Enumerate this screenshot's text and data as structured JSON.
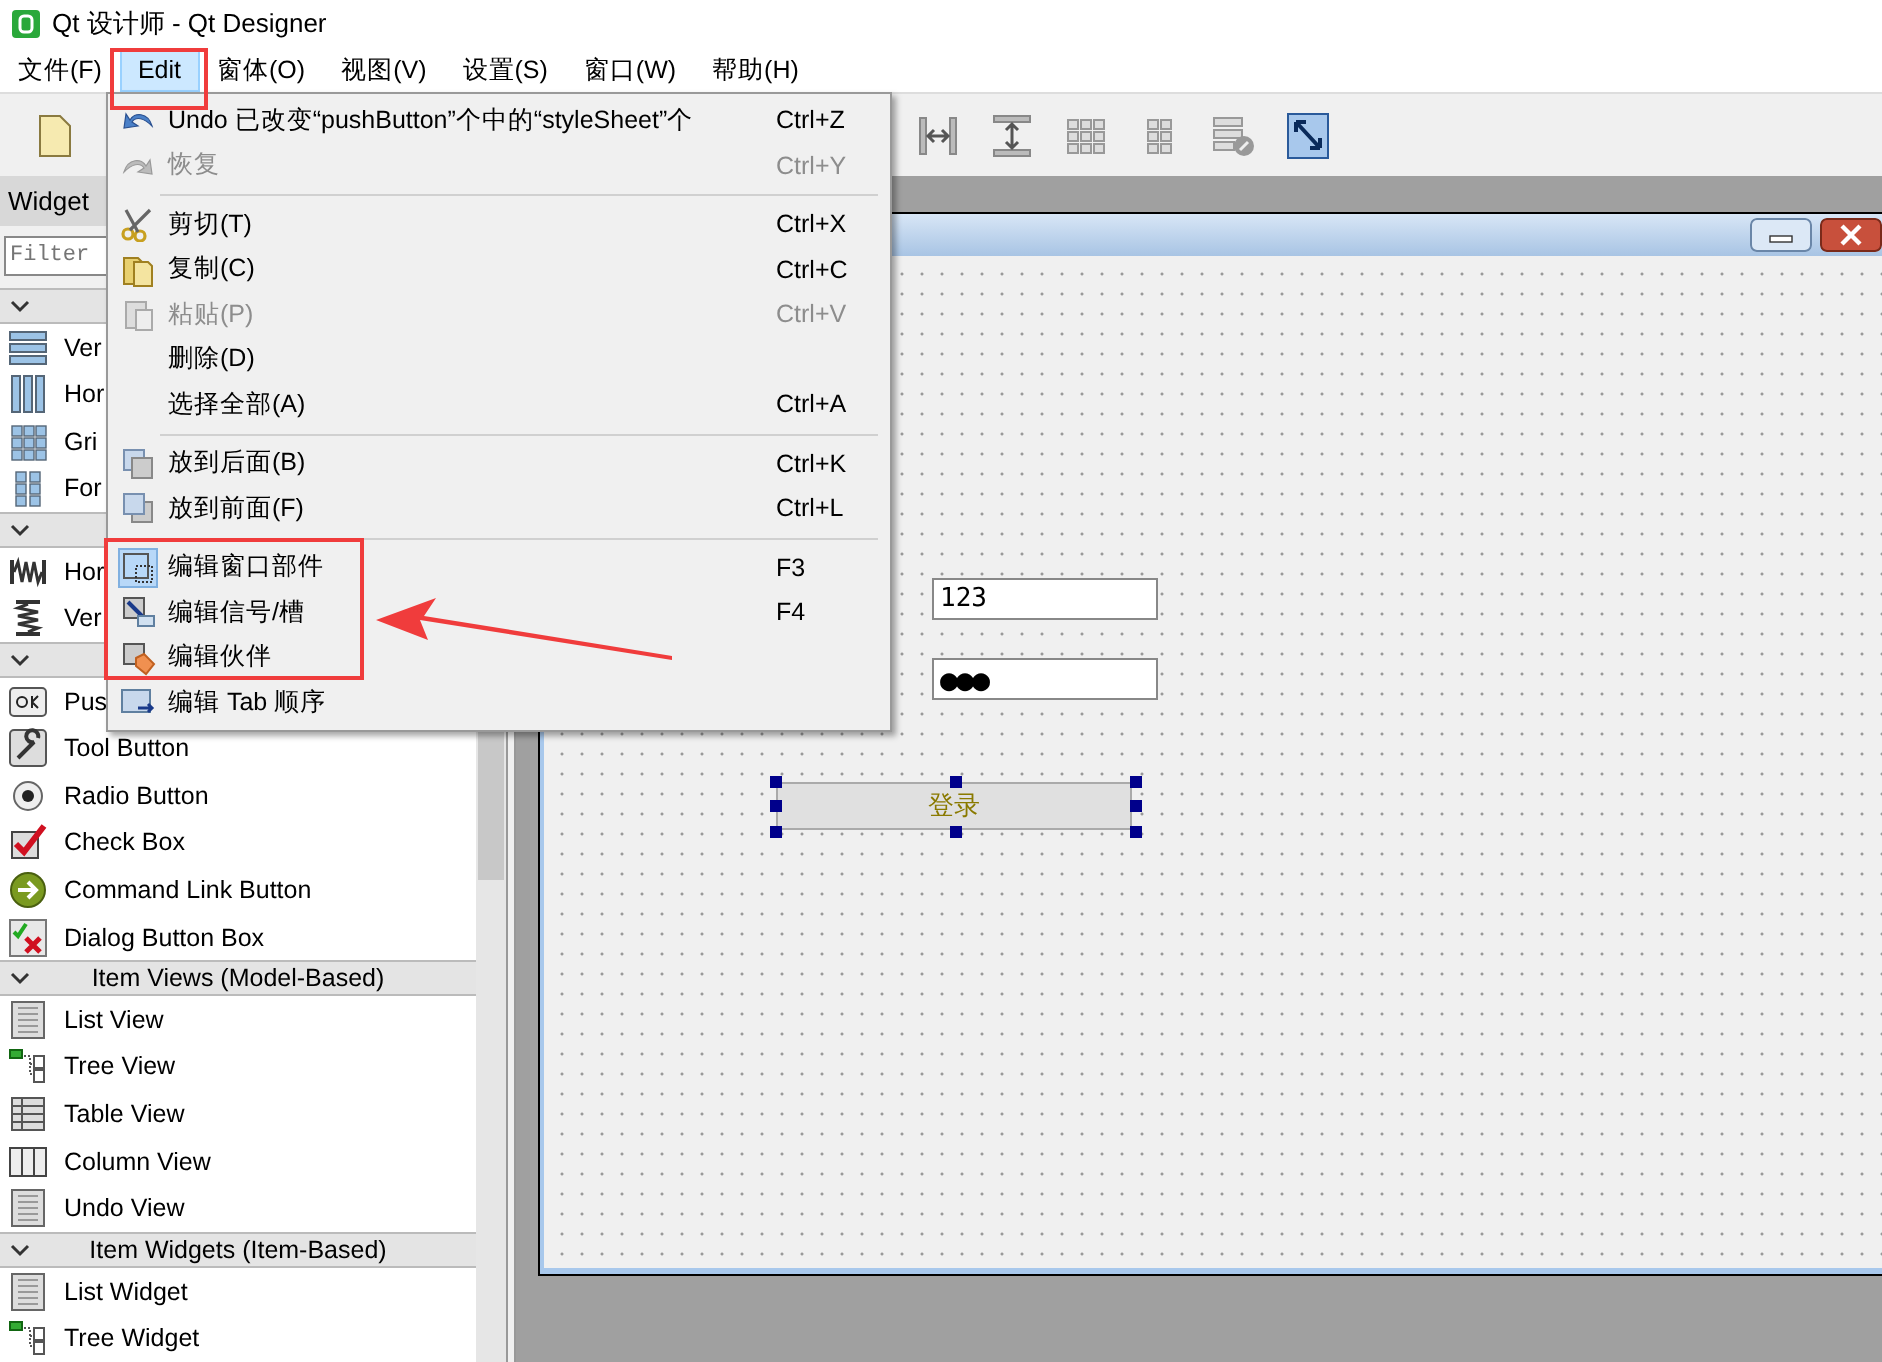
{
  "window": {
    "title": "Qt 设计师 - Qt Designer"
  },
  "menu_bar": [
    {
      "label": "文件(F)",
      "selected": false
    },
    {
      "label": "Edit",
      "selected": true
    },
    {
      "label": "窗体(O)",
      "selected": false
    },
    {
      "label": "视图(V)",
      "selected": false
    },
    {
      "label": "设置(S)",
      "selected": false
    },
    {
      "label": "窗口(W)",
      "selected": false
    },
    {
      "label": "帮助(H)",
      "selected": false
    }
  ],
  "edit_menu": [
    {
      "kind": "item",
      "label": "Undo 已改变“pushButton”个中的“styleSheet”个",
      "shortcut": "Ctrl+Z",
      "disabled": false,
      "checked": false
    },
    {
      "kind": "item",
      "label": "恢复",
      "shortcut": "Ctrl+Y",
      "disabled": true,
      "checked": false
    },
    {
      "kind": "separator"
    },
    {
      "kind": "item",
      "label": "剪切(T)",
      "shortcut": "Ctrl+X",
      "disabled": false,
      "checked": false
    },
    {
      "kind": "item",
      "label": "复制(C)",
      "shortcut": "Ctrl+C",
      "disabled": false,
      "checked": false
    },
    {
      "kind": "item",
      "label": "粘贴(P)",
      "shortcut": "Ctrl+V",
      "disabled": true,
      "checked": false
    },
    {
      "kind": "item",
      "label": "删除(D)",
      "disabled": false,
      "checked": false
    },
    {
      "kind": "item",
      "label": "选择全部(A)",
      "shortcut": "Ctrl+A",
      "disabled": false,
      "checked": false
    },
    {
      "kind": "separator"
    },
    {
      "kind": "item",
      "label": "放到后面(B)",
      "shortcut": "Ctrl+K",
      "disabled": false,
      "checked": false
    },
    {
      "kind": "item",
      "label": "放到前面(F)",
      "shortcut": "Ctrl+L",
      "disabled": false,
      "checked": false
    },
    {
      "kind": "separator"
    },
    {
      "kind": "item",
      "label": "编辑窗口部件",
      "shortcut": "F3",
      "disabled": false,
      "checked": true
    },
    {
      "kind": "item",
      "label": "编辑信号/槽",
      "shortcut": "F4",
      "disabled": false,
      "checked": false
    },
    {
      "kind": "item",
      "label": "编辑伙伴",
      "disabled": false,
      "checked": false
    },
    {
      "kind": "item",
      "label": "编辑 Tab 顺序",
      "disabled": false,
      "checked": false
    }
  ],
  "widget_box": {
    "title": "Widget",
    "filter": {
      "placeholder": "Filter"
    },
    "sections": [
      {
        "expanded": true,
        "items": [
          {
            "label": "Ver"
          },
          {
            "label": "Hor"
          },
          {
            "label": "Gri"
          },
          {
            "label": "For"
          }
        ]
      },
      {
        "expanded": true,
        "items": [
          {
            "label": "Hor"
          },
          {
            "label": "Ver"
          }
        ]
      },
      {
        "expanded": true,
        "items": [
          {
            "label": "Pus"
          },
          {
            "label": "Tool Button"
          },
          {
            "label": "Radio Button"
          },
          {
            "label": "Check Box"
          },
          {
            "label": "Command Link Button"
          },
          {
            "label": "Dialog Button Box"
          }
        ]
      },
      {
        "expanded": true,
        "title": "Item Views (Model-Based)",
        "items": [
          {
            "label": "List View"
          },
          {
            "label": "Tree View"
          },
          {
            "label": "Table View"
          },
          {
            "label": "Column View"
          },
          {
            "label": "Undo View"
          }
        ]
      },
      {
        "expanded": true,
        "title": "Item Widgets (Item-Based)",
        "items": [
          {
            "label": "List Widget"
          },
          {
            "label": "Tree Widget"
          }
        ]
      }
    ]
  },
  "form": {
    "fields": [
      {
        "kind": "text",
        "value": "123"
      },
      {
        "kind": "password",
        "value": "●●●"
      }
    ],
    "button": {
      "label": "登录",
      "selected": true
    }
  }
}
